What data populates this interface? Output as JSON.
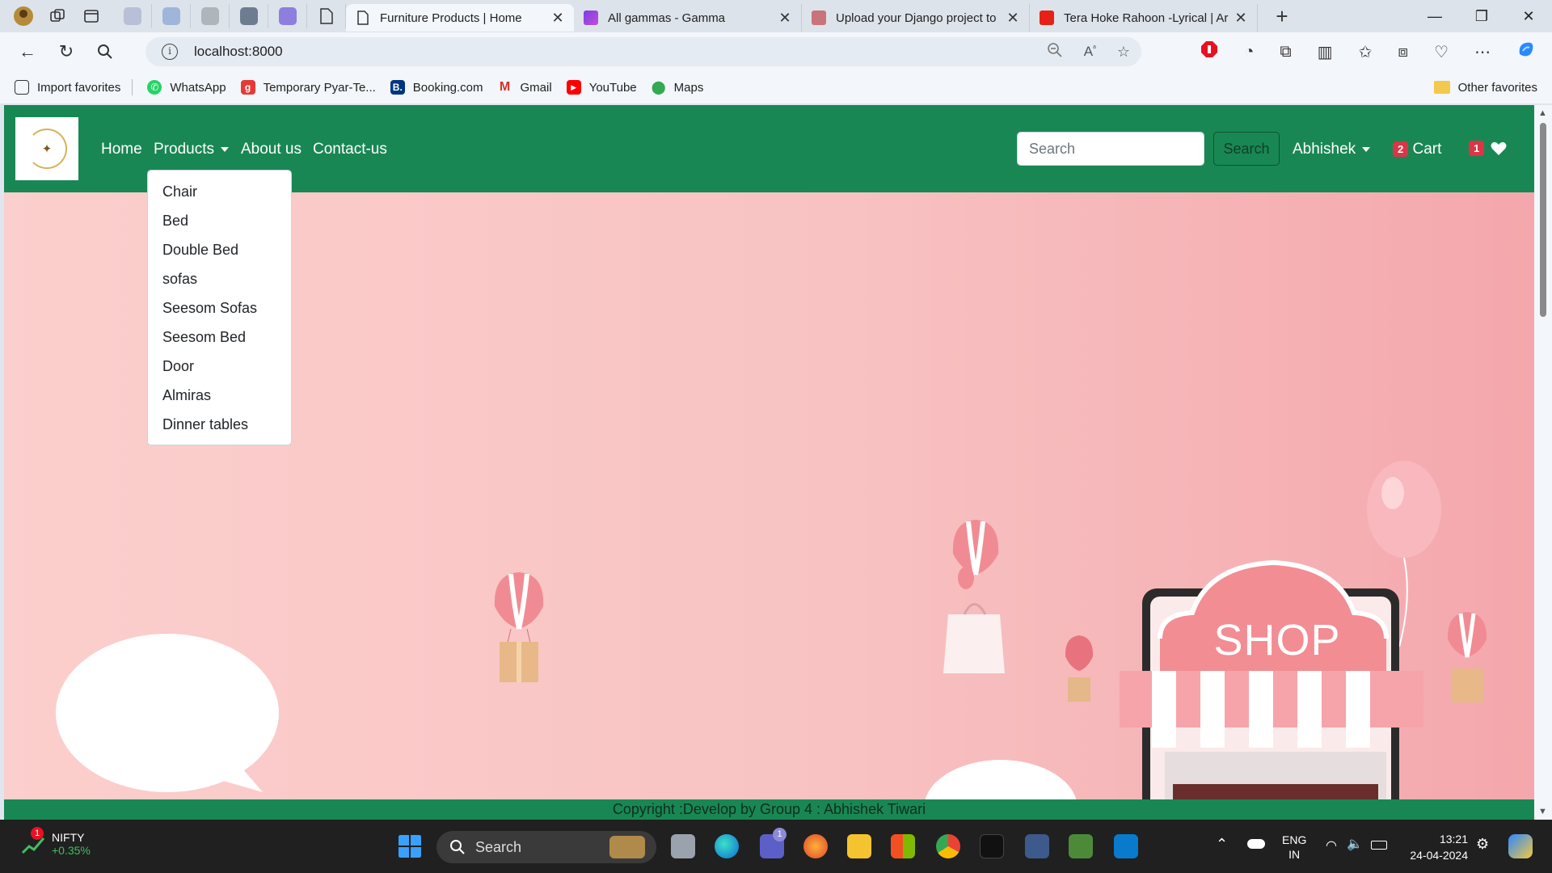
{
  "browser": {
    "tabs": [
      {
        "title": "Furniture Products | Home",
        "active": true
      },
      {
        "title": "All gammas - Gamma",
        "active": false
      },
      {
        "title": "Upload your Django project to",
        "active": false
      },
      {
        "title": "Tera Hoke Rahoon -Lyrical | Ar",
        "active": false
      }
    ],
    "url": "localhost:8000",
    "favorites": [
      "Import favorites",
      "WhatsApp",
      "Temporary Pyar-Te...",
      "Booking.com",
      "Gmail",
      "YouTube",
      "Maps"
    ],
    "other_favorites": "Other favorites"
  },
  "navbar": {
    "home": "Home",
    "products": "Products",
    "about": "About us",
    "contact": "Contact-us",
    "search_placeholder": "Search",
    "search_button": "Search",
    "user": "Abhishek",
    "cart_count": "2",
    "cart_label": "Cart",
    "wishlist_count": "1"
  },
  "dropdown": {
    "items": [
      "Chair",
      "Bed",
      "Double Bed",
      "sofas",
      "Seesom Sofas",
      "Seesom Bed",
      "Door",
      "Almiras",
      "Dinner tables"
    ]
  },
  "hero": {
    "shop_text": "SHOP"
  },
  "footer": {
    "copyright": "Copyright :Develop by Group 4 : Abhishek Tiwari"
  },
  "taskbar": {
    "stock_name": "NIFTY",
    "stock_change": "+0.35%",
    "stock_badge": "1",
    "search": "Search",
    "teams_badge": "1",
    "lang_line1": "ENG",
    "lang_line2": "IN",
    "time": "13:21",
    "date": "24-04-2024"
  },
  "colors": {
    "navbar": "#198754",
    "badge": "#dc3545",
    "hero_left": "#fbcfcd",
    "hero_right": "#f4a7ac"
  }
}
